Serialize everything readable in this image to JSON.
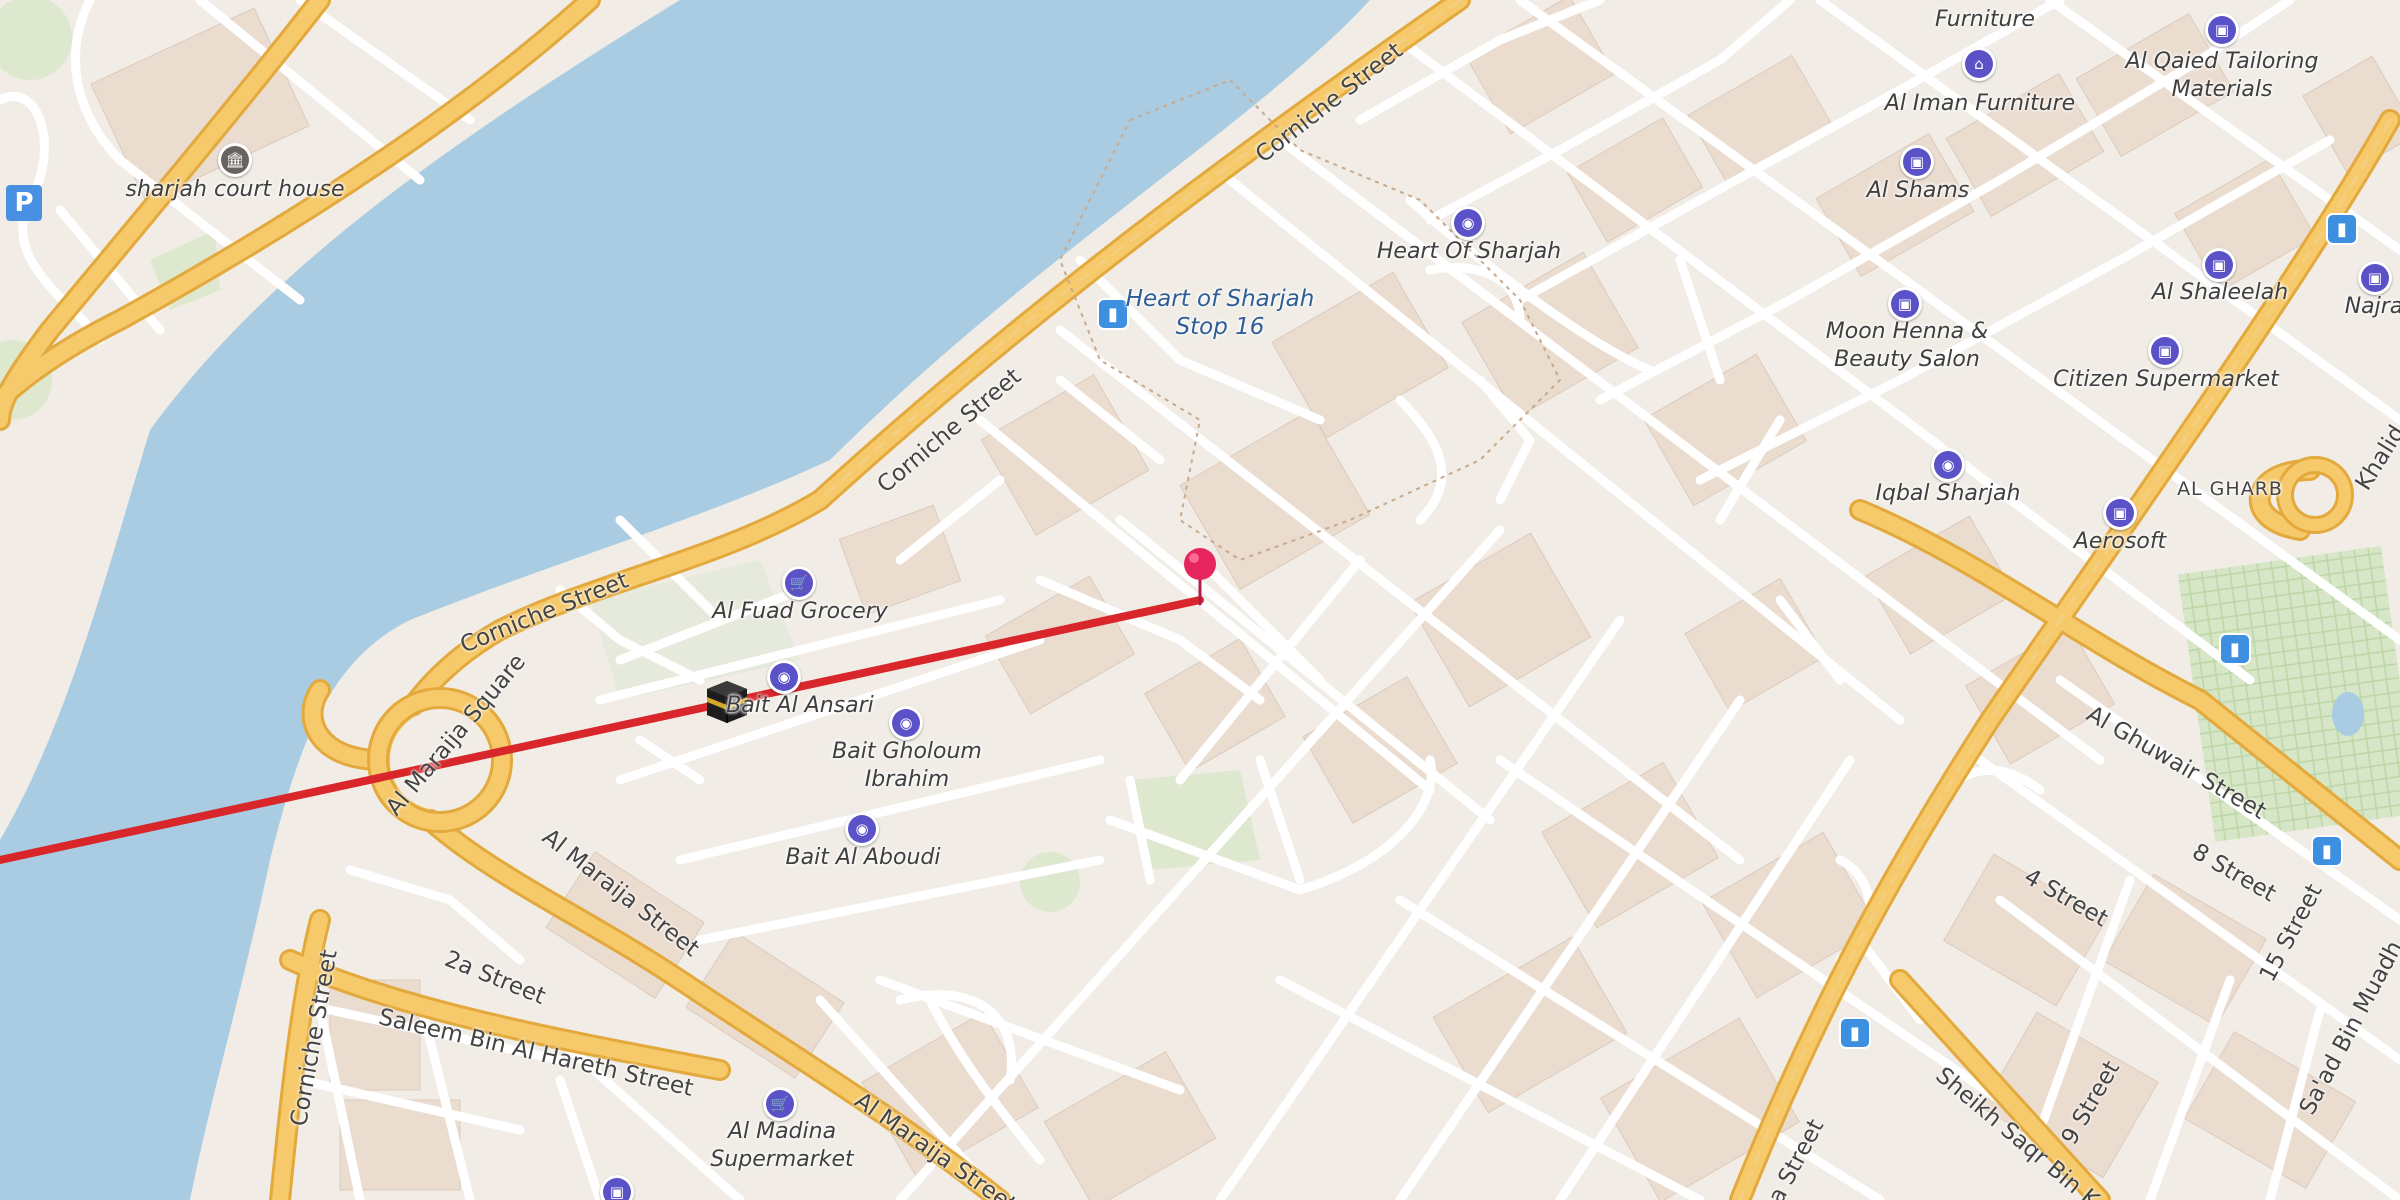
{
  "map": {
    "colors": {
      "water": "#a9cce3",
      "land": "#f1ede6",
      "major_road": "#f6c96b",
      "major_road_casing": "#e3a93c",
      "minor_road": "#ffffff",
      "park": "#dde8cf",
      "route_line": "#d8262b",
      "poi_accent": "#5b52c8",
      "transit": "#3d8fe0"
    },
    "places": [
      {
        "id": "sharjah-court-house",
        "name": "sharjah court house",
        "icon": "museum-icon"
      },
      {
        "id": "al-fuad-grocery",
        "name": "Al Fuad Grocery",
        "icon": "shopping-cart-icon"
      },
      {
        "id": "bait-al-ansari",
        "name": "Bait Al Ansari",
        "icon": "camera-icon"
      },
      {
        "id": "bait-gholoum-ibrahim",
        "name": "Bait Gholoum\nIbrahim",
        "icon": "camera-icon"
      },
      {
        "id": "bait-al-aboudi",
        "name": "Bait Al Aboudi",
        "icon": "camera-icon"
      },
      {
        "id": "heart-of-sharjah-stop",
        "name": "Heart of Sharjah\nStop 16",
        "icon": "bus-stop-icon"
      },
      {
        "id": "heart-of-sharjah",
        "name": "Heart Of Sharjah",
        "icon": "camera-icon"
      },
      {
        "id": "furniture",
        "name": "Furniture",
        "icon": "none"
      },
      {
        "id": "al-iman-furniture",
        "name": "Al Iman Furniture",
        "icon": "lamp-icon"
      },
      {
        "id": "al-shams",
        "name": "Al Shams",
        "icon": "shopping-bag-icon"
      },
      {
        "id": "al-qaied-tailoring",
        "name": "Al Qaied Tailoring\nMaterials",
        "icon": "shopping-bag-icon"
      },
      {
        "id": "moon-henna",
        "name": "Moon Henna &\nBeauty Salon",
        "icon": "shopping-bag-icon"
      },
      {
        "id": "al-shaleelah",
        "name": "Al Shaleelah",
        "icon": "shopping-bag-icon"
      },
      {
        "id": "citizen-supermarket",
        "name": "Citizen Supermarket",
        "icon": "shopping-bag-icon"
      },
      {
        "id": "iqbal-sharjah",
        "name": "Iqbal Sharjah",
        "icon": "camera-icon"
      },
      {
        "id": "aerosoft",
        "name": "Aerosoft",
        "icon": "shopping-bag-icon"
      },
      {
        "id": "najra",
        "name": "Najra",
        "icon": "shopping-bag-icon"
      },
      {
        "id": "al-gharb",
        "name": "AL GHARB",
        "icon": "none"
      },
      {
        "id": "al-madina-supermarket",
        "name": "Al Madina\nSupermarket",
        "icon": "shopping-cart-icon"
      }
    ],
    "streets": [
      {
        "id": "corniche-1",
        "name": "Corniche Street"
      },
      {
        "id": "corniche-2",
        "name": "Corniche Street"
      },
      {
        "id": "corniche-3",
        "name": "Corniche Street"
      },
      {
        "id": "corniche-4",
        "name": "Corniche Street"
      },
      {
        "id": "al-maraija-square",
        "name": "Al Maraija Square"
      },
      {
        "id": "al-maraija-street-1",
        "name": "Al Maraija Street"
      },
      {
        "id": "al-maraija-street-2",
        "name": "Al Maraija Street"
      },
      {
        "id": "2a-street",
        "name": "2a Street"
      },
      {
        "id": "saleem-bin-al-hareth",
        "name": "Saleem Bin Al Hareth Street"
      },
      {
        "id": "al-ghuwair-street",
        "name": "Al Ghuwair Street"
      },
      {
        "id": "4-street",
        "name": "4 Street"
      },
      {
        "id": "8-street",
        "name": "8 Street"
      },
      {
        "id": "15-street",
        "name": "15 Street"
      },
      {
        "id": "9-street",
        "name": "9 Street"
      },
      {
        "id": "sheikh-saqr",
        "name": "Sheikh Saqr Bin K"
      },
      {
        "id": "saad-bin-muadh",
        "name": "Sa'ad Bin Muadh"
      },
      {
        "id": "khalid",
        "name": "Khalid"
      },
      {
        "id": "ba-street",
        "name": "ba Street"
      }
    ],
    "parking_label": "P"
  }
}
